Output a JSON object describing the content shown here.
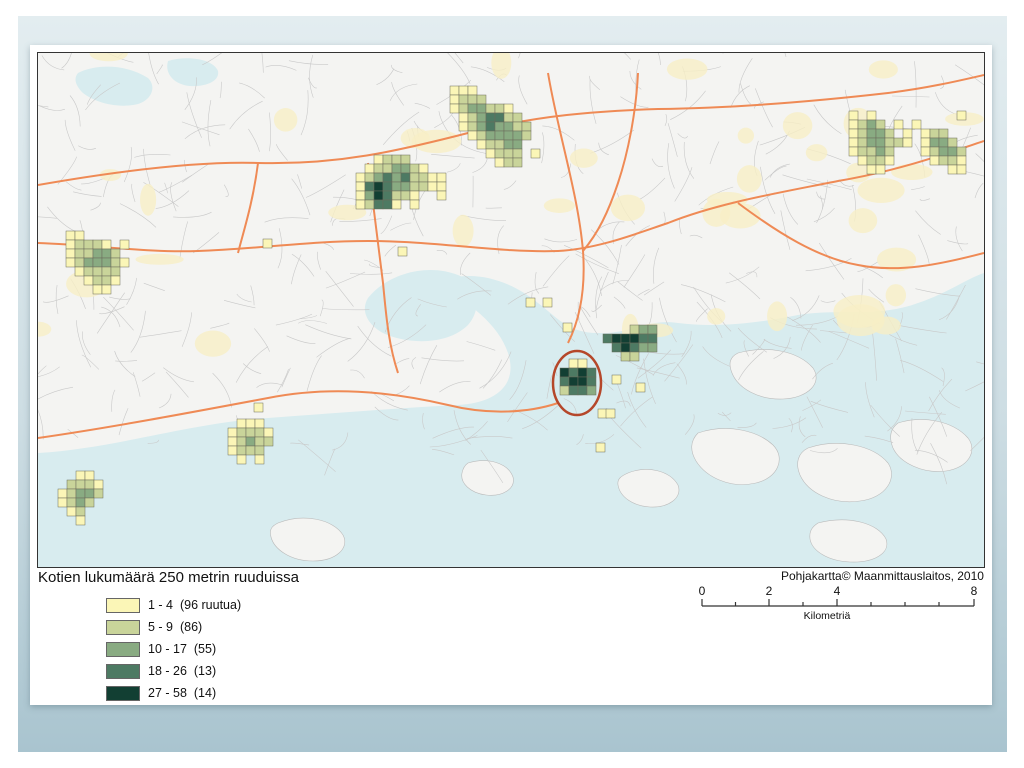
{
  "map": {
    "credit": "Pohjakartta© Maanmittauslaitos,  2010",
    "highlight_color": "#b5472a",
    "colors": {
      "land": "#f4f4f2",
      "water": "#d8ecef",
      "roads": "#c9c9c9",
      "motorway": "#ef8a55",
      "green_areas": "#f7efc6"
    }
  },
  "legend": {
    "title": "Kotien lukumäärä 250 metrin ruuduissa",
    "classes": [
      {
        "range": "1 - 4",
        "count": "(96 ruutua)",
        "color": "#fbf6b7"
      },
      {
        "range": "5 - 9",
        "count": "(86)",
        "color": "#c9d49a"
      },
      {
        "range": "10 - 17",
        "count": "(55)",
        "color": "#89ab82"
      },
      {
        "range": "18 - 26",
        "count": "(13)",
        "color": "#4d7a63"
      },
      {
        "range": "27 - 58",
        "count": "(14)",
        "color": "#123f33"
      }
    ]
  },
  "scale": {
    "ticks": [
      "0",
      "2",
      "4",
      "8"
    ],
    "unit": "Kilometriä"
  }
}
